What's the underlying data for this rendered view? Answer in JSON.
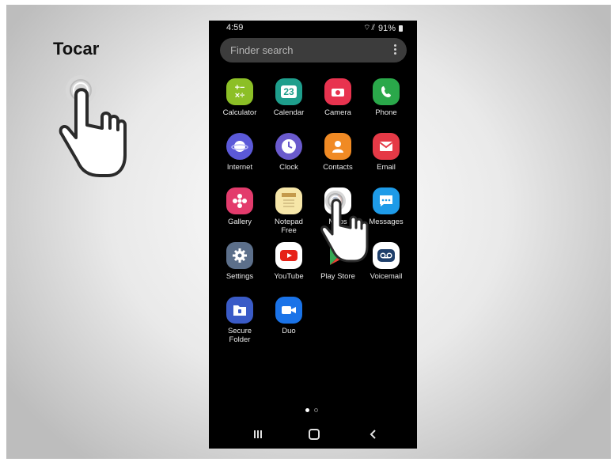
{
  "slide": {
    "gesture_title": "Tocar"
  },
  "status_bar": {
    "time": "4:59",
    "icons": "wifi signal",
    "battery": "91%"
  },
  "search": {
    "placeholder": "Finder search"
  },
  "apps": [
    {
      "label": "Calculator",
      "icon": "calculator-icon",
      "color": "#8cbf26"
    },
    {
      "label": "Calendar",
      "icon": "calendar-icon",
      "color": "#1e9e8c",
      "text": "23"
    },
    {
      "label": "Camera",
      "icon": "camera-icon",
      "color": "#e8334f"
    },
    {
      "label": "Phone",
      "icon": "phone-icon",
      "color": "#2aa84a"
    },
    {
      "label": "Internet",
      "icon": "internet-icon",
      "color": "#5b59d8"
    },
    {
      "label": "Clock",
      "icon": "clock-icon",
      "color": "#6a5acd"
    },
    {
      "label": "Contacts",
      "icon": "contacts-icon",
      "color": "#f08a24"
    },
    {
      "label": "Email",
      "icon": "email-icon",
      "color": "#e53946"
    },
    {
      "label": "Gallery",
      "icon": "gallery-icon",
      "color": "#e33b6c"
    },
    {
      "label": "Notepad\nFree",
      "icon": "notepad-icon",
      "color": "#f6e6a8"
    },
    {
      "label": "Maps",
      "icon": "maps-icon",
      "color": "#ffffff"
    },
    {
      "label": "Messages",
      "icon": "messages-icon",
      "color": "#1e9be8"
    },
    {
      "label": "Settings",
      "icon": "settings-icon",
      "color": "#5c6f8a"
    },
    {
      "label": "YouTube",
      "icon": "youtube-icon",
      "color": "#ffffff"
    },
    {
      "label": "Play Store",
      "icon": "play-store-icon",
      "color": "#000000"
    },
    {
      "label": "Voicemail",
      "icon": "voicemail-icon",
      "color": "#ffffff"
    },
    {
      "label": "Secure\nFolder",
      "icon": "secure-folder-icon",
      "color": "#3a5bc7"
    },
    {
      "label": "Duo",
      "icon": "duo-icon",
      "color": "#1a73e8"
    }
  ],
  "navigation": {
    "recents": "recents-icon",
    "home": "home-icon",
    "back": "back-icon"
  }
}
